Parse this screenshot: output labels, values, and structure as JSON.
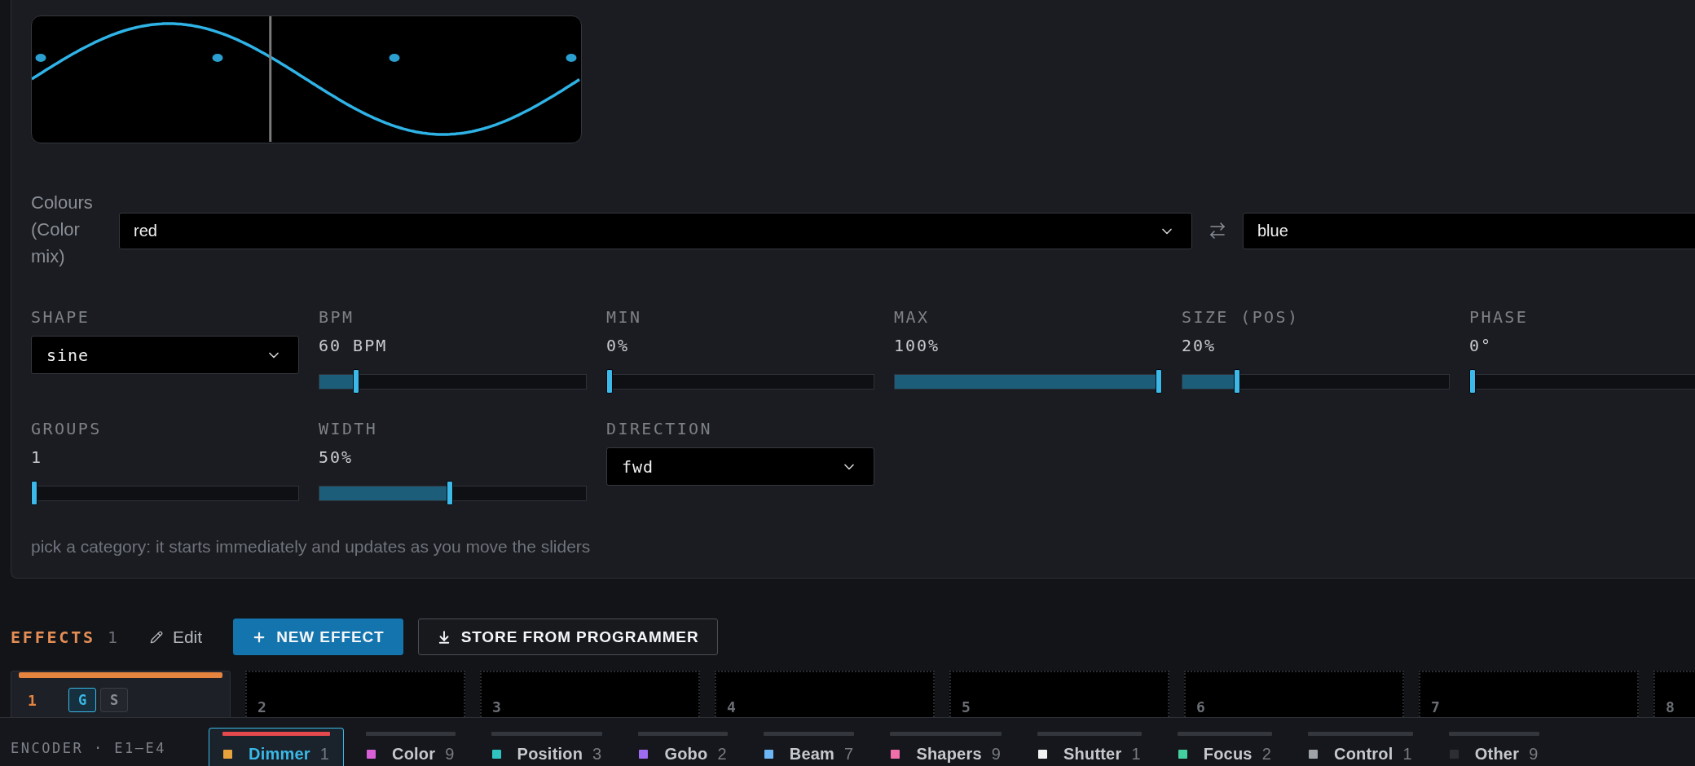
{
  "waveform": {
    "playhead": {
      "level": 0.435
    }
  },
  "colours": {
    "label": "Colours (Color mix)",
    "from": "red",
    "to": "blue"
  },
  "params": [
    {
      "kind": "select",
      "label": "SHAPE",
      "value": "sine"
    },
    {
      "kind": "slider",
      "label": "BPM",
      "value": "60 BPM",
      "level": 0.13
    },
    {
      "kind": "slider",
      "label": "MIN",
      "value": "0%",
      "level": 0
    },
    {
      "kind": "slider",
      "label": "MAX",
      "value": "100%",
      "level": 1
    },
    {
      "kind": "slider",
      "label": "SIZE (POS)",
      "value": "20%",
      "level": 0.2
    },
    {
      "kind": "slider",
      "label": "PHASE",
      "value": "0°",
      "level": 0
    },
    {
      "kind": "slider",
      "label": "GROUPS",
      "value": "1",
      "level": 0
    },
    {
      "kind": "slider",
      "label": "WIDTH",
      "value": "50%",
      "level": 0.49
    },
    {
      "kind": "select",
      "label": "DIRECTION",
      "value": "fwd"
    }
  ],
  "hint": "pick a category: it starts immediately and updates as you move the sliders",
  "effects": {
    "title": "EFFECTS",
    "count": "1",
    "edit": "Edit",
    "buttons": [
      {
        "kind": "new",
        "label": "NEW EFFECT"
      },
      {
        "kind": "store",
        "label": "STORE FROM PROGRAMMER"
      }
    ],
    "slots": [
      {
        "kind": "effect",
        "number": "1",
        "toggles": [
          {
            "label": "G",
            "on": true
          },
          {
            "label": "S",
            "on": false
          }
        ]
      },
      {
        "kind": "empty",
        "number": "2"
      },
      {
        "kind": "empty",
        "number": "3"
      },
      {
        "kind": "empty",
        "number": "4"
      },
      {
        "kind": "empty",
        "number": "5"
      },
      {
        "kind": "empty",
        "number": "6"
      },
      {
        "kind": "empty",
        "number": "7"
      },
      {
        "kind": "empty",
        "number": "8"
      }
    ]
  },
  "encoder": {
    "label": "ENCODER · E1–E4",
    "categories": [
      {
        "name": "Dimmer",
        "count": "1",
        "color": "#e8a33d",
        "selected": true
      },
      {
        "name": "Color",
        "count": "9",
        "color": "#d95fd6",
        "selected": false
      },
      {
        "name": "Position",
        "count": "3",
        "color": "#2ec5c0",
        "selected": false
      },
      {
        "name": "Gobo",
        "count": "2",
        "color": "#9c6cf2",
        "selected": false
      },
      {
        "name": "Beam",
        "count": "7",
        "color": "#6cb6f5",
        "selected": false
      },
      {
        "name": "Shapers",
        "count": "9",
        "color": "#f06eaa",
        "selected": false
      },
      {
        "name": "Shutter",
        "count": "1",
        "color": "#f2f2f2",
        "selected": false
      },
      {
        "name": "Focus",
        "count": "2",
        "color": "#44d1a0",
        "selected": false
      },
      {
        "name": "Control",
        "count": "1",
        "color": "#9ea3aa",
        "selected": false
      },
      {
        "name": "Other",
        "count": "9",
        "color": "#2c2e33",
        "selected": false
      }
    ]
  }
}
